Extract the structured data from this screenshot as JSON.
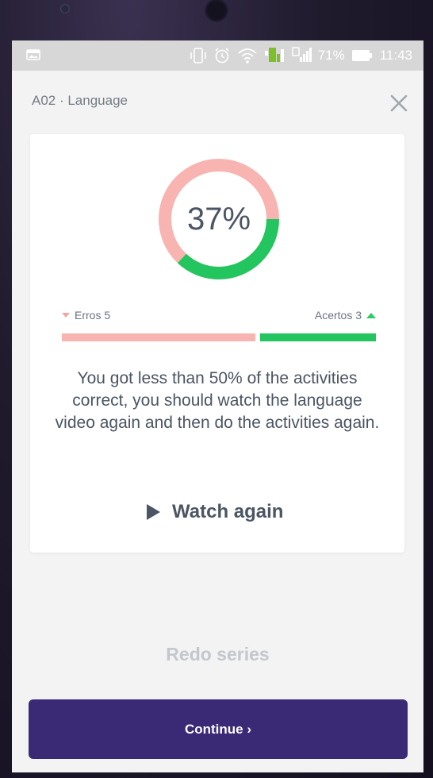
{
  "status_bar": {
    "battery": "71%",
    "time": "11:43"
  },
  "header": {
    "title": "A02 · Language"
  },
  "result": {
    "percent_label": "37%",
    "percent_value": 37,
    "errors_label": "Erros 5",
    "errors_count": 5,
    "correct_label": "Acertos 3",
    "correct_count": 3,
    "message": "You got less than 50% of the activities correct, you should watch the language video again and then do the activities again.",
    "watch_again_label": "Watch again"
  },
  "actions": {
    "redo_label": "Redo series",
    "continue_label": "Continue ›"
  },
  "colors": {
    "wrong": "#f8b4b0",
    "correct": "#22c55e",
    "primary": "#3a2a76"
  }
}
